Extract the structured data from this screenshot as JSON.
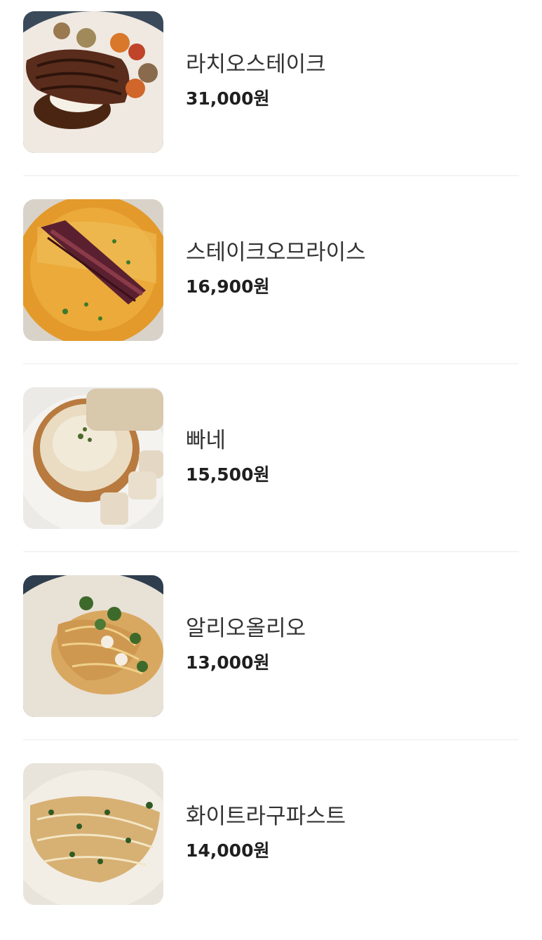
{
  "menu": {
    "items": [
      {
        "name": "라치오스테이크",
        "price": "31,000원",
        "image": "steak-plate"
      },
      {
        "name": "스테이크오므라이스",
        "price": "16,900원",
        "image": "steak-omurice"
      },
      {
        "name": "빠네",
        "price": "15,500원",
        "image": "pane-bread-bowl"
      },
      {
        "name": "알리오올리오",
        "price": "13,000원",
        "image": "aglio-olio"
      },
      {
        "name": "화이트라구파스트",
        "price": "14,000원",
        "image": "white-ragu-pasta"
      }
    ]
  }
}
